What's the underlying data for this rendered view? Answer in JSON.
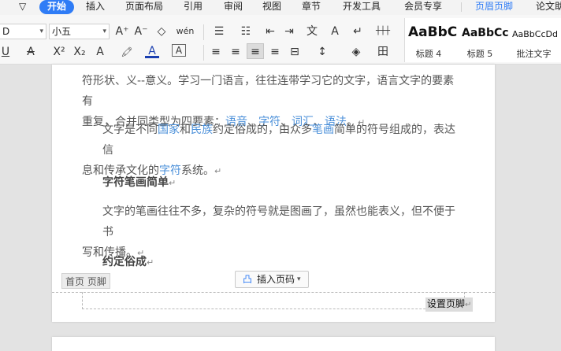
{
  "tabs": {
    "dropdown": "▽",
    "start": "开始",
    "insert": "插入",
    "page_layout": "页面布局",
    "references": "引用",
    "review": "审阅",
    "view": "视图",
    "chapter": "章节",
    "developer": "开发工具",
    "vip": "会员专享",
    "header_footer": "页眉页脚",
    "thesis": "论文助"
  },
  "toolbar": {
    "font_name": "D",
    "font_size": "小五",
    "grow_font": "A⁺",
    "shrink_font": "A⁻",
    "clear_format": "◇",
    "phonetic": "wén",
    "bullets": "☰",
    "numbering": "☷",
    "outdent": "⇤",
    "indent": "⇥",
    "chinese_layout": "文",
    "text_direction": "A",
    "show_marks": "↵",
    "ruler": "┼┼┼",
    "underline": "U",
    "strike": "A",
    "superscript": "X²",
    "subscript": "X₂",
    "text_effect": "A",
    "highlight": "🖍",
    "font_color": "A",
    "char_border": "A",
    "align_left": "≡",
    "align_center": "≡",
    "align_right": "≡",
    "justify": "≡",
    "distributed": "⊟",
    "line_spacing": "↕",
    "shading": "◈",
    "borders": "田"
  },
  "styles": [
    {
      "preview": "AaBbC",
      "label": "标题 4"
    },
    {
      "preview": "AaBbCc",
      "label": "标题 5"
    },
    {
      "preview": "AaBbCcDd",
      "label": "批注文字"
    }
  ],
  "doc": {
    "p1_l1": "符形状、义--意义。学习一门语言，往往连带学习它的文字，语言文字的要素有",
    "p1_l2_a": "重复，合并同类型为四要素：",
    "p1_l2_k1": "语音",
    "p1_l2_s1": "、",
    "p1_l2_k2": "字符",
    "p1_l2_s2": "、",
    "p1_l2_k3": "词汇",
    "p1_l2_s3": "、",
    "p1_l2_k4": "语法",
    "p1_l2_end": "。",
    "para_mark": "↵",
    "p2_l1_a": "文字是不同",
    "p2_l1_k1": "国家",
    "p2_l1_b": "和",
    "p2_l1_k2": "民族",
    "p2_l1_c": "约定俗成的，由众多",
    "p2_l1_k3": "笔画",
    "p2_l1_d": "简单的符号组成的，表达信",
    "p2_l2_a": "息和传承文化的",
    "p2_l2_k": "字符",
    "p2_l2_b": "系统。",
    "heading1": "字符笔画简单",
    "p3_l1": "文字的笔画往往不多，复杂的符号就是图画了，虽然也能表义，但不便于书",
    "p3_l2": "写和传播。",
    "heading2": "约定俗成"
  },
  "footer": {
    "tag": "首页 页脚",
    "insert_page_number": "插入页码",
    "insert_icon": "凸",
    "dropdown": "▾",
    "set_footer": "设置页脚"
  }
}
